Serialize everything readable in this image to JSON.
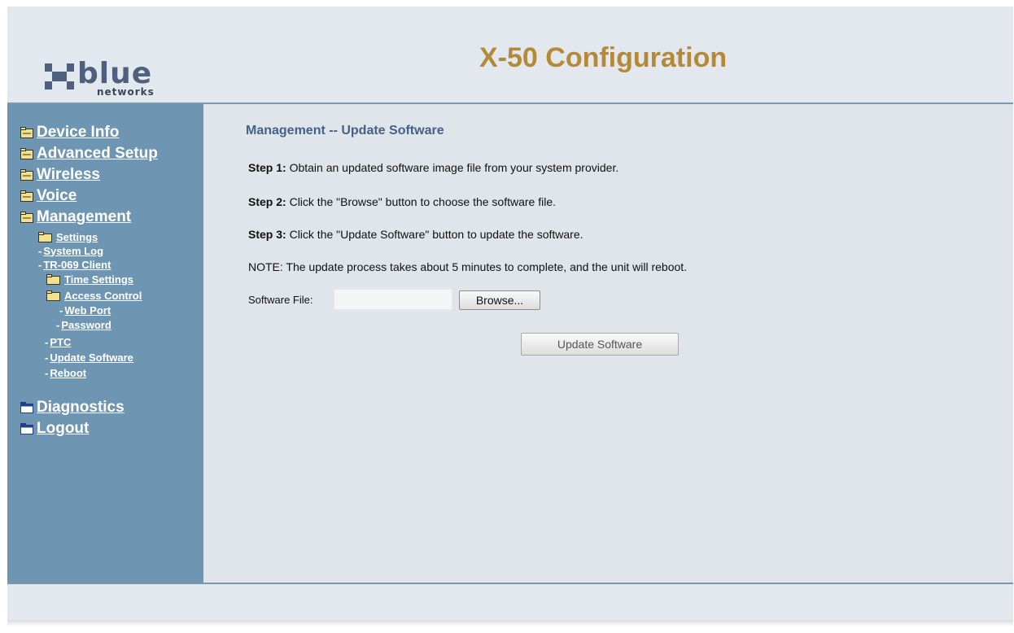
{
  "header": {
    "logo_word": "blue",
    "logo_sub": "networks",
    "title": "X-50 Configuration"
  },
  "sidebar": {
    "items": [
      {
        "label": "Device Info",
        "icon": "folder-icon"
      },
      {
        "label": "Advanced Setup",
        "icon": "folder-icon"
      },
      {
        "label": "Wireless",
        "icon": "folder-icon"
      },
      {
        "label": "Voice",
        "icon": "folder-icon"
      },
      {
        "label": "Management",
        "icon": "folder-open-icon"
      },
      {
        "label": "Diagnostics",
        "icon": "folder-closed-icon"
      },
      {
        "label": "Logout",
        "icon": "folder-closed-icon"
      }
    ],
    "management_sub": [
      {
        "label": "Settings"
      },
      {
        "label": "System Log"
      },
      {
        "label": "TR-069 Client"
      },
      {
        "label": "Time Settings"
      },
      {
        "label": "Access Control"
      },
      {
        "label": "Web Port"
      },
      {
        "label": "Password"
      },
      {
        "label": "PTC"
      },
      {
        "label": "Update Software"
      },
      {
        "label": "Reboot"
      }
    ]
  },
  "main": {
    "heading": "Management -- Update Software",
    "steps": [
      {
        "label": "Step 1:",
        "text": " Obtain an updated software image file from your system provider."
      },
      {
        "label": "Step 2:",
        "text": " Click the \"Browse\" button to choose the software file."
      },
      {
        "label": "Step 3:",
        "text": " Click the \"Update Software\" button to update the software."
      }
    ],
    "note": "NOTE: The update process takes about 5 minutes to complete, and the unit will reboot.",
    "file_label": "Software File:",
    "file_value": "",
    "browse_label": "Browse...",
    "update_label": "Update Software"
  },
  "colors": {
    "sidebar_bg": "#6e96b2",
    "title": "#b48a38",
    "heading": "#44618a"
  }
}
